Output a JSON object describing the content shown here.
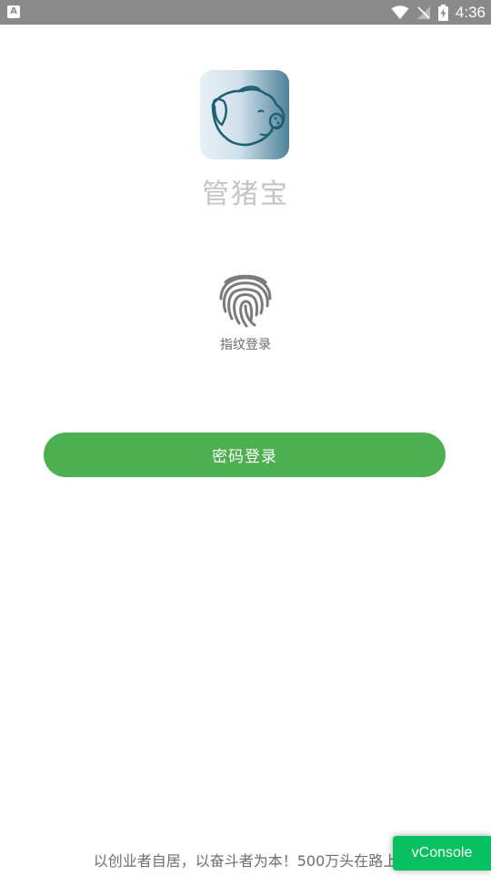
{
  "status_bar": {
    "notification_icon": "A",
    "time": "4:36",
    "icons": [
      "wifi-icon",
      "signal-off-icon",
      "battery-charging-icon"
    ]
  },
  "app": {
    "logo_icon": "pig-logo-icon",
    "name": "管猪宝"
  },
  "fingerprint": {
    "icon": "fingerprint-icon",
    "label": "指纹登录"
  },
  "login": {
    "password_button_label": "密码登录",
    "button_color": "#4caf50"
  },
  "footer": {
    "slogan": "以创业者自居，以奋斗者为本！500万头在路上"
  },
  "vconsole": {
    "label": "vConsole",
    "color": "#07c160"
  }
}
